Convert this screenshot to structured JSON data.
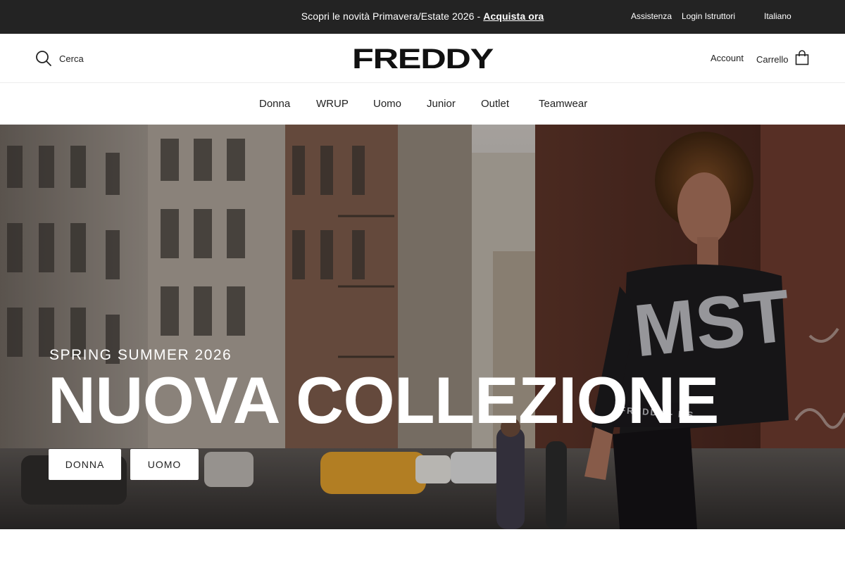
{
  "announcement": {
    "text": "Scopri le novità Primavera/Estate 2026 -",
    "link": "Acquista ora"
  },
  "utility_links": {
    "support": "Assistenza",
    "instructor_login": "Login Istruttori",
    "language": "Italiano"
  },
  "header": {
    "search_label": "Cerca",
    "logo_text": "FREDDY",
    "account_label": "Account",
    "cart_label": "Carrello"
  },
  "nav": {
    "items": [
      {
        "label": "Donna"
      },
      {
        "label": "WRUP"
      },
      {
        "label": "Uomo"
      },
      {
        "label": "Junior"
      },
      {
        "label": "Outlet"
      },
      {
        "label": "Teamwear"
      }
    ]
  },
  "hero": {
    "eyebrow": "SPRING SUMMER 2026",
    "headline": "NUOVA COLLEZIONE",
    "buttons": [
      {
        "label": "DONNA"
      },
      {
        "label": "UOMO"
      }
    ],
    "sweater_print": "MST",
    "waistband_text": "FREDDY - MS"
  },
  "icons": {
    "search": "search-icon",
    "cart": "shopping-bag-icon"
  },
  "colors": {
    "topbar": "#232323",
    "background": "#ffffff",
    "text": "#1a1a1a"
  }
}
